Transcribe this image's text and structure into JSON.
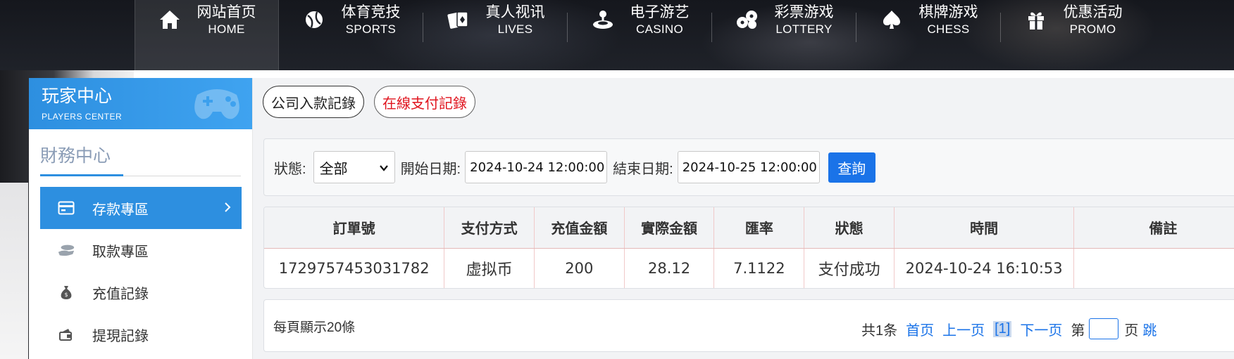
{
  "nav": {
    "items": [
      {
        "cn": "网站首页",
        "en": "HOME",
        "icon": "home-icon"
      },
      {
        "cn": "体育竞技",
        "en": "SPORTS",
        "icon": "ball-icon"
      },
      {
        "cn": "真人视讯",
        "en": "LIVES",
        "icon": "cards-icon"
      },
      {
        "cn": "电子游艺",
        "en": "CASINO",
        "icon": "joystick-icon"
      },
      {
        "cn": "彩票游戏",
        "en": "LOTTERY",
        "icon": "lottery-balls-icon"
      },
      {
        "cn": "棋牌游戏",
        "en": "CHESS",
        "icon": "spade-icon"
      },
      {
        "cn": "优惠活动",
        "en": "PROMO",
        "icon": "gift-icon"
      }
    ],
    "active": "HOME"
  },
  "sidebar": {
    "header_cn": "玩家中心",
    "header_en": "PLAYERS CENTER",
    "section_title": "財務中心",
    "items": [
      {
        "label": "存款專區",
        "icon": "card-icon",
        "active": true
      },
      {
        "label": "取款專區",
        "icon": "coins-icon",
        "active": false
      },
      {
        "label": "充值記錄",
        "icon": "money-bag-icon",
        "active": false
      },
      {
        "label": "提現記錄",
        "icon": "wallet-icon",
        "active": false
      }
    ]
  },
  "tabs": [
    "公司入款記錄",
    "在線支付記錄"
  ],
  "filter": {
    "status_label": "狀態:",
    "status_value": "全部",
    "start_label": "開始日期:",
    "start_value": "2024-10-24 12:00:00",
    "end_label": "結束日期:",
    "end_value": "2024-10-25 12:00:00",
    "query_label": "查詢"
  },
  "table": {
    "headers": [
      "訂單號",
      "支付方式",
      "充值金額",
      "實際金額",
      "匯率",
      "狀態",
      "時間",
      "備註"
    ],
    "rows": [
      [
        "1729757453031782",
        "虚拟币",
        "200",
        "28.12",
        "7.1122",
        "支付成功",
        "2024-10-24 16:10:53",
        ""
      ]
    ]
  },
  "pager": {
    "per_page": "每頁顯示20條",
    "total": "共1条",
    "first": "首页",
    "prev": "上一页",
    "current": "[1]",
    "next": "下一页",
    "goto_prefix": "第",
    "goto_suffix": "页",
    "jump": "跳"
  },
  "colors": {
    "accent": "#2d8fe0",
    "query_button": "#1a73e8",
    "online_tab_text": "#e0141e"
  }
}
